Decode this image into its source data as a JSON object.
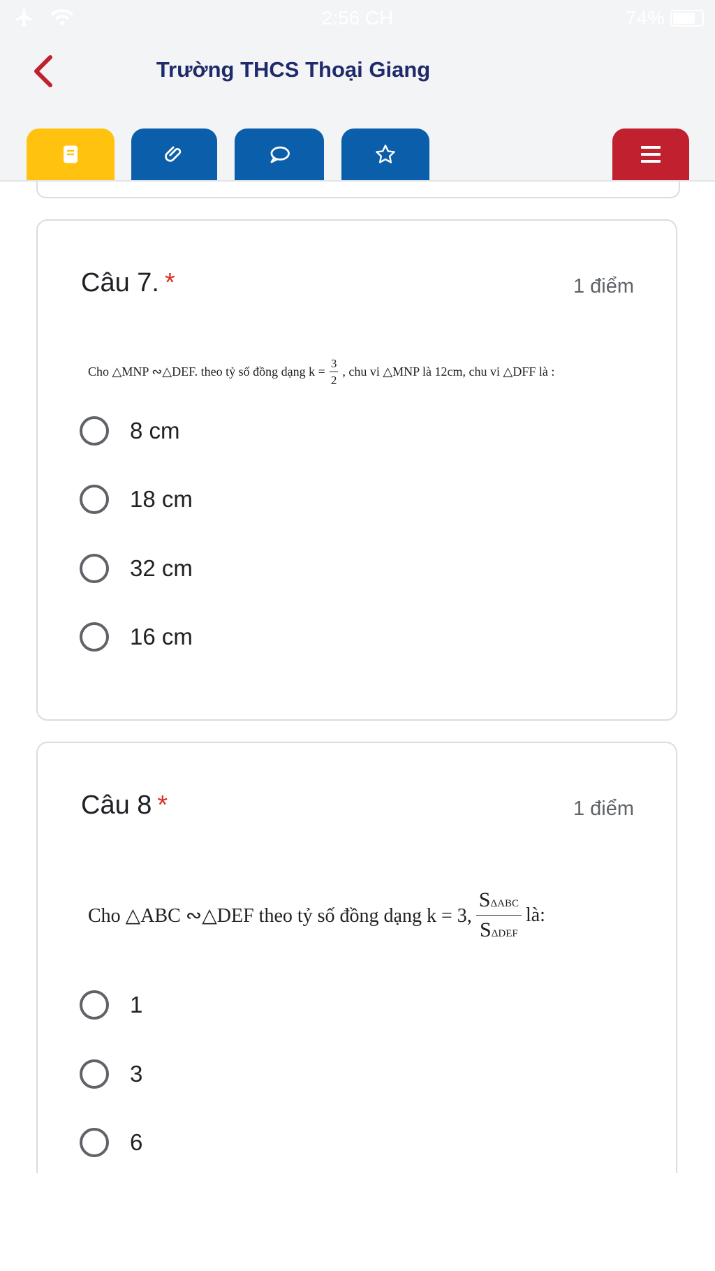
{
  "status_bar": {
    "time": "2:56 CH",
    "battery": "74%"
  },
  "header": {
    "title": "Trường THCS Thoại Giang"
  },
  "toolbar": {
    "tabs": [
      {
        "icon": "book-icon",
        "color": "#ffc20e"
      },
      {
        "icon": "paperclip-icon",
        "color": "#0b5eaa"
      },
      {
        "icon": "chat-bubble-icon",
        "color": "#0b5eaa"
      },
      {
        "icon": "star-icon",
        "color": "#0b5eaa"
      },
      {
        "icon": "menu-icon",
        "color": "#c1202f"
      }
    ]
  },
  "questions": [
    {
      "title": "Câu 7.",
      "required_mark": "*",
      "points": "1 điểm",
      "text_before": "Cho △MNP ∾△DEF. theo tỷ số đồng dạng k =",
      "frac_num": "3",
      "frac_den": "2",
      "text_after": ", chu vi △MNP là 12cm, chu vi △DFF là :",
      "options": [
        "8 cm",
        "18 cm",
        "32 cm",
        "16 cm"
      ]
    },
    {
      "title": "Câu 8",
      "required_mark": "*",
      "points": "1 điểm",
      "text_before": "Cho △ABC ∾△DEF theo tỷ số đồng dạng k = 3,",
      "frac_num_main": "S",
      "frac_num_sub": "ΔABC",
      "frac_den_main": "S",
      "frac_den_sub": "ΔDEF",
      "text_after": "là:",
      "options": [
        "1",
        "3",
        "6"
      ]
    }
  ]
}
